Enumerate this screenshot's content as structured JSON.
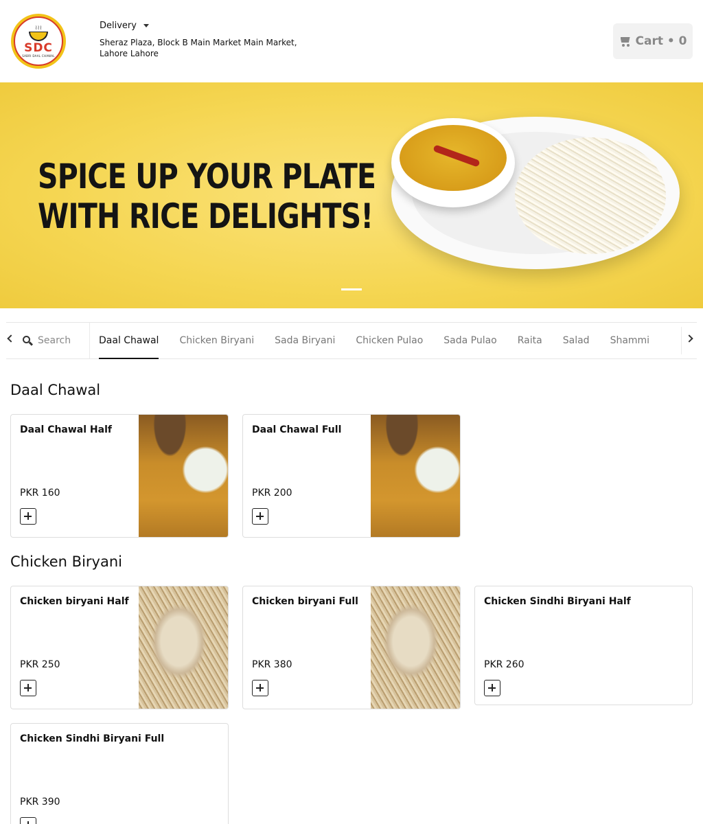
{
  "header": {
    "logo": {
      "text": "SDC",
      "subtext": "SABRI DAAL CHAWAL",
      "icon": "bowl-logo"
    },
    "delivery_label": "Delivery",
    "address": "Sheraz Plaza, Block B Main Market Main Market, Lahore Lahore",
    "cart": {
      "label": "Cart • 0",
      "icon": "cart-icon"
    }
  },
  "banner": {
    "headline_line1": "SPICE UP YOUR PLATE",
    "headline_line2": "WITH RICE DELIGHTS!",
    "slide_count": 1,
    "active_slide": 1
  },
  "category_bar": {
    "search_placeholder": "Search",
    "active": "Daal Chawal",
    "categories": [
      "Daal Chawal",
      "Chicken Biryani",
      "Sada Biryani",
      "Chicken Pulao",
      "Sada Pulao",
      "Raita",
      "Salad",
      "Shammi"
    ]
  },
  "sections": [
    {
      "title": "Daal Chawal",
      "items": [
        {
          "name": "Daal Chawal Half",
          "price": "PKR 160",
          "image": "daal-chawal"
        },
        {
          "name": "Daal Chawal Full",
          "price": "PKR 200",
          "image": "daal-chawal"
        }
      ]
    },
    {
      "title": "Chicken Biryani",
      "items": [
        {
          "name": "Chicken biryani Half",
          "price": "PKR 250",
          "image": "chicken-biryani"
        },
        {
          "name": "Chicken biryani Full",
          "price": "PKR 380",
          "image": "chicken-biryani"
        },
        {
          "name": "Chicken Sindhi Biryani Half",
          "price": "PKR 260",
          "image": ""
        },
        {
          "name": "Chicken Sindhi Biryani Full",
          "price": "PKR 390",
          "image": ""
        }
      ]
    }
  ]
}
